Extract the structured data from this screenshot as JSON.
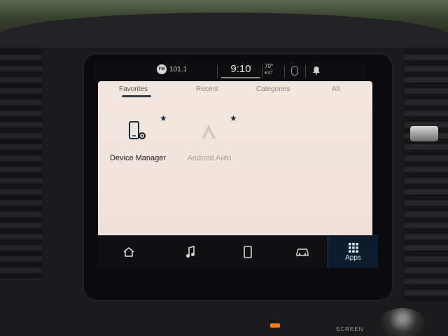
{
  "status": {
    "radio_badge": "FM",
    "radio_station": "101.1",
    "time": "9:10",
    "temperature": "70°",
    "temperature_label": "EXT"
  },
  "tabs": [
    {
      "label": "Favorites",
      "active": true
    },
    {
      "label": "Recent",
      "active": false
    },
    {
      "label": "Categories",
      "active": false
    },
    {
      "label": "All",
      "active": false
    }
  ],
  "apps": [
    {
      "label": "Device Manager",
      "favorite": true,
      "enabled": true
    },
    {
      "label": "Android Auto",
      "favorite": true,
      "enabled": false
    }
  ],
  "dock": {
    "apps_label": "Apps"
  },
  "hardware": {
    "screen_label": "SCREEN"
  },
  "colors": {
    "screen_bg": "#f0e4dd",
    "accent": "#2f3b4a",
    "dock_active": "#0d1c2c"
  },
  "icons": {
    "device_manager": "phone-gear-icon",
    "android_auto": "android-auto-icon",
    "favorite": "star-icon",
    "home": "home-icon",
    "media": "music-note-icon",
    "phone": "phone-icon",
    "vehicle": "car-icon",
    "apps": "grid-icon",
    "notifications": "bell-icon",
    "voice": "mic-icon"
  }
}
